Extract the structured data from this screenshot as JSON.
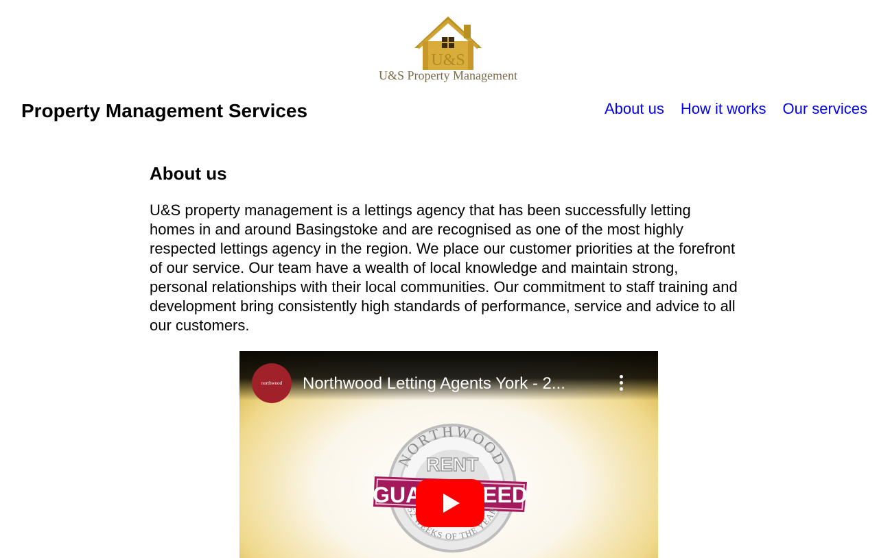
{
  "logo": {
    "letters": "U&S",
    "name": "U&S Property Management"
  },
  "header": {
    "site_title": "Property Management Services",
    "nav": [
      {
        "label": "About us"
      },
      {
        "label": "How it works"
      },
      {
        "label": "Our services"
      }
    ]
  },
  "about": {
    "heading": "About us",
    "text": "U&S property management is a lettings agency that has been successfully letting homes in and around Basingstoke and are recognised as one of the most highly respected lettings agency in the region. We place our customer priorities at the forefront of our service. Our team have a wealth of local knowledge and maintain strong, personal relationships with their local communities. Our commitment to staff training and development bring consistently high standards of performance, service and advice to all our customers."
  },
  "video": {
    "title": "Northwood Letting Agents York - 2...",
    "channel_avatar_text": "northwood",
    "seal_top_text": "NORTHWOOD",
    "seal_rent": "RENT",
    "seal_banner": "GUARANTEED",
    "seal_bottom_text": "52 WEEKS OF THE YEAR",
    "icons": {
      "menu": "more-vert-icon",
      "play": "play-icon"
    },
    "colors": {
      "play_red": "#ff0000",
      "banner_magenta": "#a3195b",
      "gold": "#c99a1f"
    }
  }
}
